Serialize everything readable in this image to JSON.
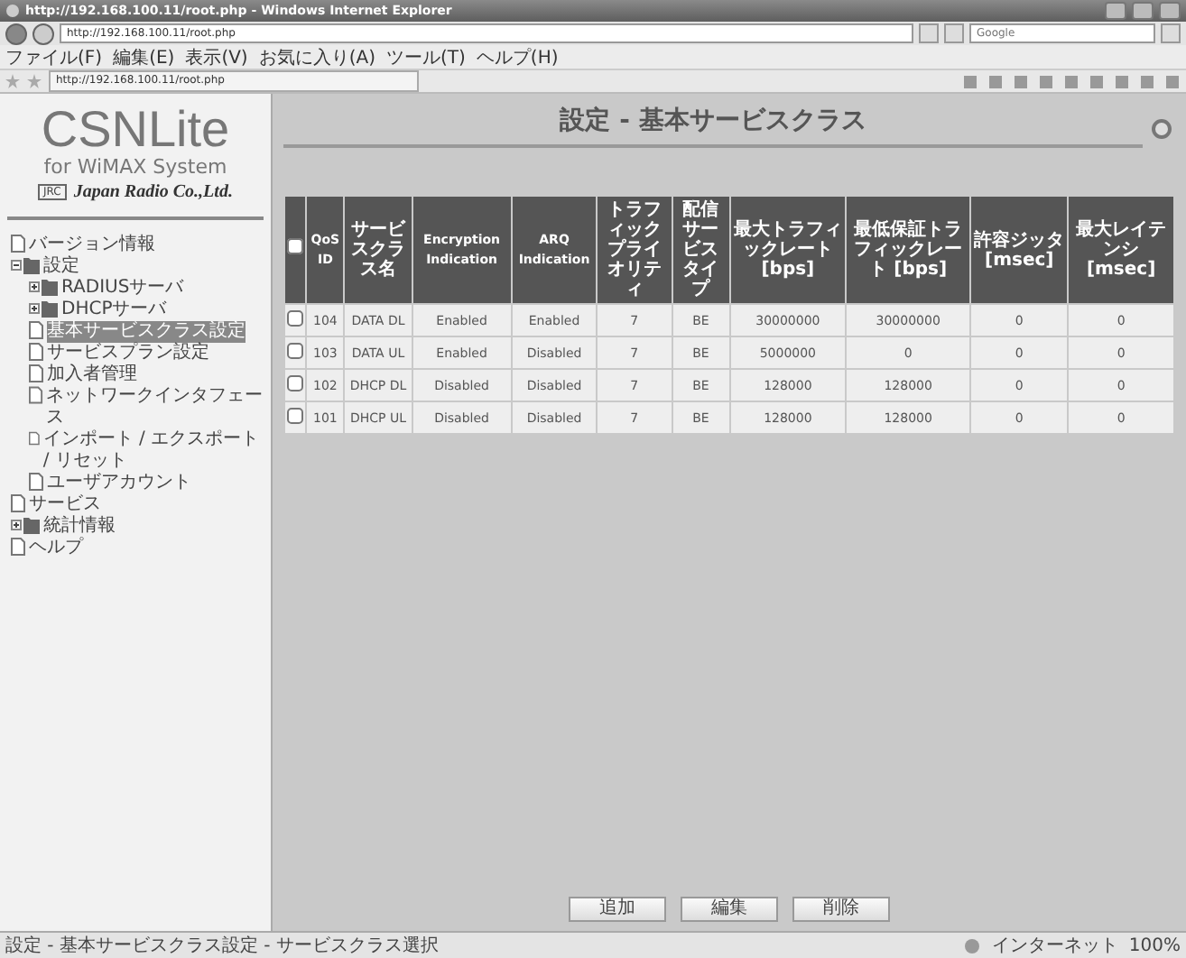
{
  "browser": {
    "title": "http://192.168.100.11/root.php - Windows Internet Explorer",
    "address": "http://192.168.100.11/root.php",
    "search_placeholder": "Google",
    "menu": [
      "ファイル(F)",
      "編集(E)",
      "表示(V)",
      "お気に入り(A)",
      "ツール(T)",
      "ヘルプ(H)"
    ],
    "tab_title": "http://192.168.100.11/root.php"
  },
  "sidebar": {
    "logo": {
      "title": "CSNLite",
      "subtitle": "for WiMAX System",
      "badge": "JRC",
      "company": "Japan Radio Co.,Ltd."
    },
    "tree": [
      {
        "label": "バージョン情報",
        "kind": "page",
        "selected": false
      },
      {
        "label": "設定",
        "kind": "folder",
        "expanded": true,
        "selected": false,
        "children": [
          {
            "label": "RADIUSサーバ",
            "kind": "folder",
            "expanded": false,
            "selected": false
          },
          {
            "label": "DHCPサーバ",
            "kind": "folder",
            "expanded": false,
            "selected": false
          },
          {
            "label": "基本サービスクラス設定",
            "kind": "page",
            "selected": true
          },
          {
            "label": "サービスプラン設定",
            "kind": "page",
            "selected": false
          },
          {
            "label": "加入者管理",
            "kind": "page",
            "selected": false
          },
          {
            "label": "ネットワークインタフェース",
            "kind": "page",
            "selected": false
          },
          {
            "label": "インポート / エクスポート / リセット",
            "kind": "page",
            "selected": false
          },
          {
            "label": "ユーザアカウント",
            "kind": "page",
            "selected": false
          }
        ]
      },
      {
        "label": "サービス",
        "kind": "page",
        "selected": false
      },
      {
        "label": "統計情報",
        "kind": "folder",
        "expanded": false,
        "selected": false
      },
      {
        "label": "ヘルプ",
        "kind": "page",
        "selected": false
      }
    ]
  },
  "page": {
    "title": "設定 - 基本サービスクラス",
    "table": {
      "select_all_checked": false,
      "columns": [
        "QoS ID",
        "サービスクラス名",
        "Encryption Indication",
        "ARQ Indication",
        "トラフィックプライオリティ",
        "配信サービスタイプ",
        "最大トラフィックレート [bps]",
        "最低保証トラフィックレート [bps]",
        "許容ジッタ [msec]",
        "最大レイテンシ [msec]"
      ],
      "rows": [
        {
          "checked": false,
          "cells": [
            "104",
            "DATA DL",
            "Enabled",
            "Enabled",
            "7",
            "BE",
            "30000000",
            "30000000",
            "0",
            "0"
          ]
        },
        {
          "checked": false,
          "cells": [
            "103",
            "DATA UL",
            "Enabled",
            "Disabled",
            "7",
            "BE",
            "5000000",
            "0",
            "0",
            "0"
          ]
        },
        {
          "checked": false,
          "cells": [
            "102",
            "DHCP DL",
            "Disabled",
            "Disabled",
            "7",
            "BE",
            "128000",
            "128000",
            "0",
            "0"
          ]
        },
        {
          "checked": false,
          "cells": [
            "101",
            "DHCP UL",
            "Disabled",
            "Disabled",
            "7",
            "BE",
            "128000",
            "128000",
            "0",
            "0"
          ]
        }
      ]
    },
    "buttons": [
      "追加",
      "編集",
      "削除"
    ]
  },
  "status_bar": {
    "text": "設定 - 基本サービスクラス設定 - サービスクラス選択",
    "zone": "インターネット",
    "zoom": "100%"
  }
}
